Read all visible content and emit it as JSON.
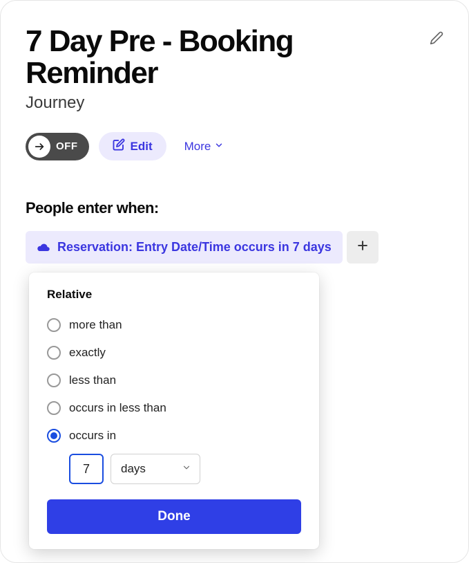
{
  "header": {
    "title": "7 Day Pre - Booking Reminder",
    "subtitle": "Journey"
  },
  "toolbar": {
    "toggle_label": "OFF",
    "edit_label": "Edit",
    "more_label": "More"
  },
  "section": {
    "enter_title": "People enter when:"
  },
  "condition": {
    "text": "Reservation: Entry Date/Time occurs in 7 days"
  },
  "popover": {
    "title": "Relative",
    "options": {
      "more_than": "more than",
      "exactly": "exactly",
      "less_than": "less than",
      "occurs_in_less_than": "occurs in less than",
      "occurs_in": "occurs in"
    },
    "value": "7",
    "unit": "days",
    "done_label": "Done"
  }
}
